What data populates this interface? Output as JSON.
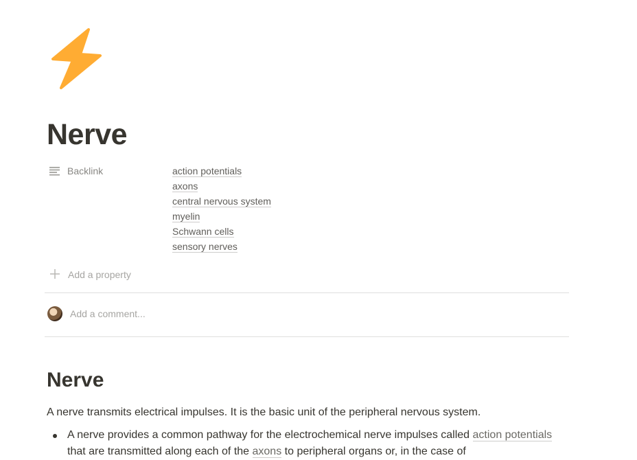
{
  "page": {
    "icon": "lightning-bolt-icon",
    "title": "Nerve"
  },
  "properties": {
    "backlink": {
      "label": "Backlink",
      "icon": "text-lines-icon",
      "links": [
        "action potentials",
        "axons",
        "central nervous system",
        "myelin",
        "Schwann cells",
        "sensory nerves"
      ]
    },
    "add_property_label": "Add a property"
  },
  "comment": {
    "placeholder": "Add a comment..."
  },
  "content": {
    "heading": "Nerve",
    "paragraph": "A nerve transmits electrical impulses. It is the basic unit of the peripheral nervous system.",
    "bullet": {
      "text_1": "A nerve provides a common pathway for the electrochemical nerve impulses called ",
      "link_1": "action potentials",
      "text_2": " that are transmitted along each of the ",
      "link_2": "axons",
      "text_3": " to peripheral organs or, in the case of"
    }
  },
  "colors": {
    "icon_fill": "#FFAC33",
    "text": "#37352f",
    "muted": "rgba(55,53,47,0.6)"
  }
}
